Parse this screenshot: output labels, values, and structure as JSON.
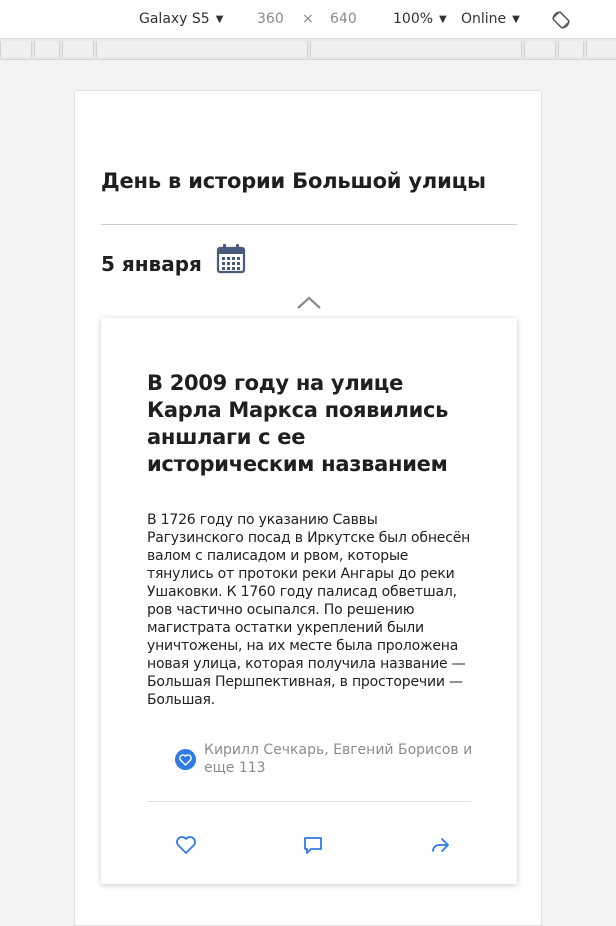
{
  "toolbar": {
    "device": "Galaxy S5",
    "width": "360",
    "times": "×",
    "height": "640",
    "zoom": "100%",
    "network": "Online",
    "rotate_icon": "rotate-icon"
  },
  "page": {
    "title": "День в истории Большой улицы",
    "date": "5 января",
    "calendar_icon": "calendar-icon",
    "collapse_icon": "chevron-up-icon"
  },
  "card": {
    "title": "В 2009 году на улице Карла Маркса появились аншлаги с ее историческим названием",
    "body": "В 1726 году по указанию Саввы Рагузинского посад в Иркутске был обнесён валом с палисадом и рвом, которые тянулись от протоки реки Ангары до реки Ушаковки. К 1760 году палисад обветшал, ров частично осыпался. По решению магистрата остатки укреплений были уничтожены, на их месте была проложена новая улица, которая получила название — Большая Першпективная, в просторечии — Большая.",
    "likes_text": "Кирилл Сечкарь, Евгений Борисов и еще 113",
    "actions": {
      "like_icon": "heart-icon",
      "comment_icon": "comment-icon",
      "share_icon": "share-icon"
    }
  },
  "colors": {
    "accent": "#2f7ae5",
    "muted_text": "#8c8c8c",
    "heading": "#1f1f1f"
  }
}
